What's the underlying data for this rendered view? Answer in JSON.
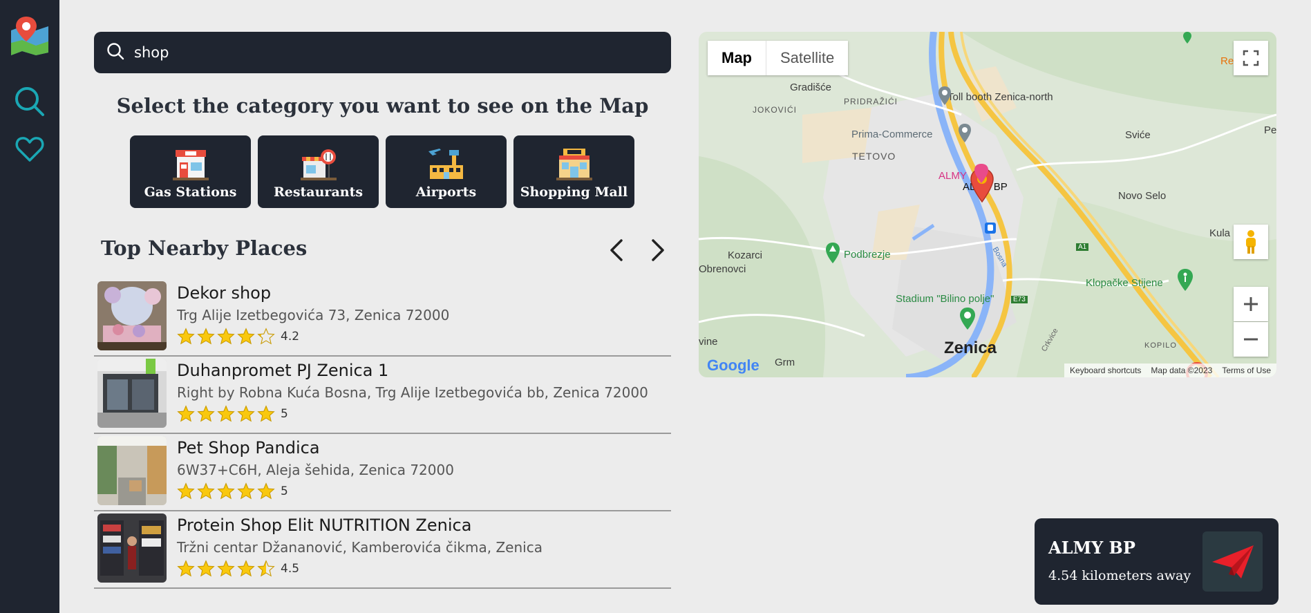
{
  "sidebar": {
    "items": [
      {
        "icon": "map-logo-icon"
      },
      {
        "icon": "search-icon"
      },
      {
        "icon": "heart-icon"
      }
    ]
  },
  "search": {
    "value": "shop",
    "icon": "search-icon"
  },
  "categories": {
    "title": "Select the category you want to see on the Map",
    "items": [
      {
        "label": "Gas Stations",
        "icon": "gas-station-icon"
      },
      {
        "label": "Restaurants",
        "icon": "restaurant-icon"
      },
      {
        "label": "Airports",
        "icon": "airport-icon"
      },
      {
        "label": "Shopping Mall",
        "icon": "shopping-mall-icon"
      }
    ]
  },
  "nearby": {
    "title": "Top Nearby Places",
    "places": [
      {
        "name": "Dekor shop",
        "address": "Trg Alije Izetbegovića 73, Zenica 72000",
        "rating": "4.2",
        "stars": 4.2
      },
      {
        "name": "Duhanpromet PJ Zenica 1",
        "address": "Right by Robna Kuća Bosna, Trg Alije Izetbegovića bb, Zenica 72000",
        "rating": "5",
        "stars": 5
      },
      {
        "name": "Pet Shop Pandica",
        "address": "6W37+C6H, Aleja šehida, Zenica 72000",
        "rating": "5",
        "stars": 5
      },
      {
        "name": "Protein Shop Elit NUTRITION Zenica",
        "address": "Tržni centar Džananović, Kamberovića čikma, Zenica",
        "rating": "4.5",
        "stars": 4.5
      }
    ]
  },
  "map": {
    "tabs": [
      "Map",
      "Satellite"
    ],
    "labels": {
      "gradisce": "Gradišće",
      "jokovici": "JOKOVIĆI",
      "pridrazici": "PRIDRAŽIĆI",
      "toll": "Toll booth Zenica-north",
      "prima": "Prima-Commerce",
      "svice": "Sviće",
      "tetovo": "TETOVO",
      "almy_pink": "ALMY",
      "almy": "ALMY BP",
      "novo_selo": "Novo Selo",
      "kozarci": "Kozarci",
      "obrenovci": "Obrenovci",
      "podbrezje": "Podbrezje",
      "kula": "Kula",
      "klopacke": "Klopačke Stijene",
      "stadium": "Stadium \"Bilino polje\"",
      "zenica": "Zenica",
      "vine": "vine",
      "grm": "Grm",
      "kopilo": "KOPILO",
      "a1": "A1",
      "e73": "E73",
      "bosna": "Bosna",
      "crkvice": "Crkvice",
      "re": "Re",
      "pe": "Pe"
    },
    "footer": [
      "Keyboard shortcuts",
      "Map data ©2023",
      "Terms of Use"
    ],
    "google": "Google"
  },
  "card": {
    "title": "ALMY BP",
    "distance": "4.54 kilometers away",
    "icon": "paper-plane-icon"
  }
}
